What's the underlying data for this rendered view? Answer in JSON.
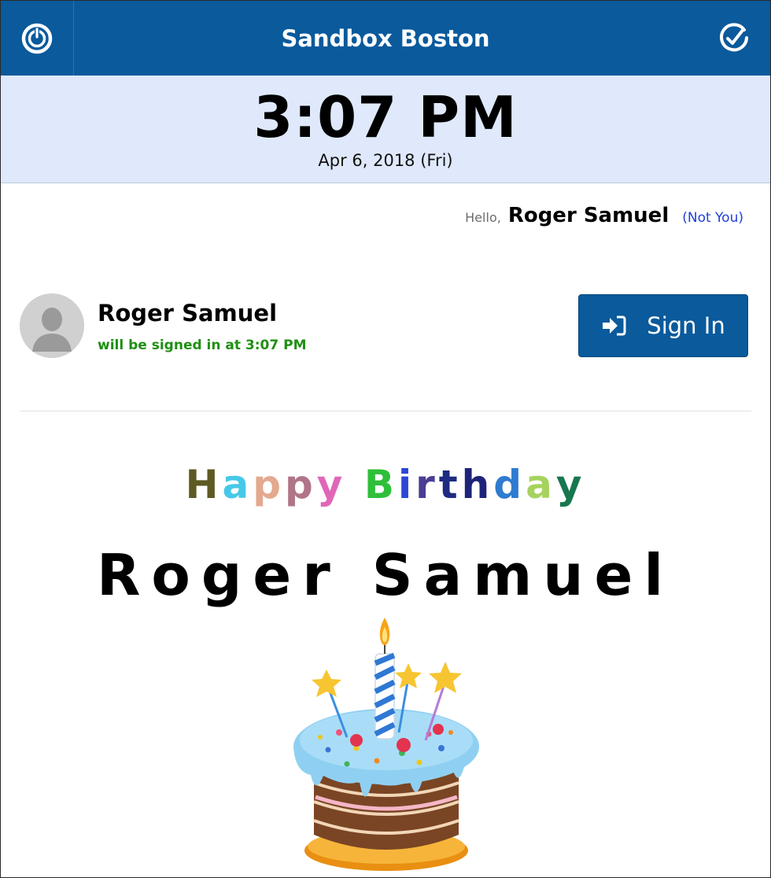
{
  "header": {
    "title": "Sandbox Boston",
    "left_icon": "power-icon",
    "right_icon": "clock-check-icon"
  },
  "clock": {
    "time": "3:07 PM",
    "date": "Apr 6, 2018 (Fri)"
  },
  "greeting": {
    "hello": "Hello,",
    "name": "Roger Samuel",
    "not_you": "(Not You)"
  },
  "person": {
    "name": "Roger Samuel",
    "status": "will be signed in at 3:07 PM",
    "avatar_icon": "user-avatar-icon"
  },
  "signin": {
    "label": "Sign In",
    "icon": "sign-in-icon"
  },
  "birthday": {
    "letters": [
      {
        "char": "H",
        "color": "#5e5a23"
      },
      {
        "char": "a",
        "color": "#46c8e8"
      },
      {
        "char": "p",
        "color": "#e4a98f"
      },
      {
        "char": "p",
        "color": "#b07586"
      },
      {
        "char": "y",
        "color": "#e067b7"
      },
      {
        "char": " ",
        "color": "#000000"
      },
      {
        "char": "B",
        "color": "#2fbf3a"
      },
      {
        "char": "i",
        "color": "#2c47d6"
      },
      {
        "char": "r",
        "color": "#4a3e94"
      },
      {
        "char": "t",
        "color": "#1d2b80"
      },
      {
        "char": "h",
        "color": "#1e237a"
      },
      {
        "char": "d",
        "color": "#2f7bd0"
      },
      {
        "char": "a",
        "color": "#a6d35f"
      },
      {
        "char": "y",
        "color": "#17774f"
      }
    ],
    "name": "Roger Samuel",
    "image_icon": "birthday-cake-icon"
  },
  "colors": {
    "header_bg": "#0a5a9c",
    "clock_bg": "#dfe9fb",
    "status_green": "#1f8f12",
    "link_blue": "#1f3fd8"
  }
}
